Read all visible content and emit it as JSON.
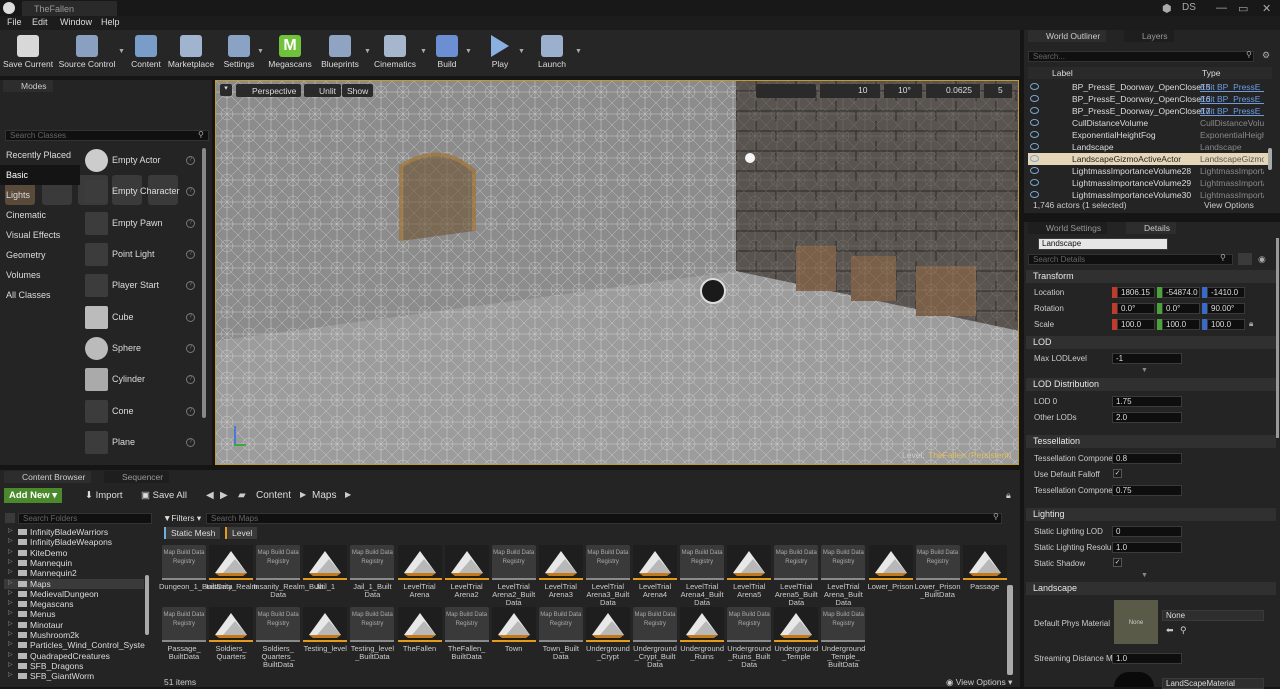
{
  "window": {
    "tab_title": "TheFallen",
    "user_badge": "DS"
  },
  "menu": [
    "File",
    "Edit",
    "Window",
    "Help"
  ],
  "toolbar": [
    {
      "label": "Save Current",
      "icon": "save-icon"
    },
    {
      "label": "Source Control",
      "icon": "source-control-icon"
    },
    {
      "label": "Content",
      "icon": "content-icon"
    },
    {
      "label": "Marketplace",
      "icon": "marketplace-icon"
    },
    {
      "label": "Settings",
      "icon": "settings-icon"
    },
    {
      "label": "Megascans",
      "icon": "megascans-icon"
    },
    {
      "label": "Blueprints",
      "icon": "blueprints-icon"
    },
    {
      "label": "Cinematics",
      "icon": "cinematics-icon"
    },
    {
      "label": "Build",
      "icon": "build-icon"
    },
    {
      "label": "Play",
      "icon": "play-icon"
    },
    {
      "label": "Launch",
      "icon": "launch-icon"
    }
  ],
  "modes": {
    "tab": "Modes",
    "search_placeholder": "Search Classes",
    "categories": [
      "Recently Placed",
      "Basic",
      "Lights",
      "Cinematic",
      "Visual Effects",
      "Geometry",
      "Volumes",
      "All Classes"
    ],
    "selected_category": "Basic",
    "items": [
      "Empty Actor",
      "Empty Character",
      "Empty Pawn",
      "Point Light",
      "Player Start",
      "Cube",
      "Sphere",
      "Cylinder",
      "Cone",
      "Plane"
    ]
  },
  "viewport": {
    "perspective": "Perspective",
    "view_mode": "Unlit",
    "show": "Show",
    "grid_snap": "10",
    "rotation_snap": "10°",
    "scale_snap": "0.0625",
    "camera_speed": "5",
    "level_label": "Level:",
    "level_name": "TheFallen (Persistent)"
  },
  "outliner": {
    "tabs": [
      "World Outliner",
      "Layers"
    ],
    "search_placeholder": "Search...",
    "col_label": "Label",
    "col_type": "Type",
    "rows": [
      {
        "label": "BP_PressE_Doorway_OpenClose15",
        "type": "Edit BP_PressE_",
        "link": true
      },
      {
        "label": "BP_PressE_Doorway_OpenClose16",
        "type": "Edit BP_PressE_",
        "link": true
      },
      {
        "label": "BP_PressE_Doorway_OpenClose17",
        "type": "Edit BP_PressE_",
        "link": true
      },
      {
        "label": "CullDistanceVolume",
        "type": "CullDistanceVolume",
        "link": false
      },
      {
        "label": "ExponentialHeightFog",
        "type": "ExponentialHeight",
        "link": false
      },
      {
        "label": "Landscape",
        "type": "Landscape",
        "link": false
      },
      {
        "label": "LandscapeGizmoActiveActor",
        "type": "LandscapeGizmo",
        "link": false
      },
      {
        "label": "LightmassImportanceVolume28",
        "type": "LightmassImporta",
        "link": false
      },
      {
        "label": "LightmassImportanceVolume29",
        "type": "LightmassImporta",
        "link": false
      },
      {
        "label": "LightmassImportanceVolume30",
        "type": "LightmassImporta",
        "link": false
      }
    ],
    "status": "1,746 actors (1 selected)",
    "view_options": "View Options"
  },
  "details": {
    "tabs": [
      "World Settings",
      "Details"
    ],
    "actor_name": "Landscape",
    "search_placeholder": "Search Details",
    "transform": {
      "section": "Transform",
      "location_label": "Location",
      "location": [
        "1806.15",
        "-54874.0",
        "-1410.0"
      ],
      "rotation_label": "Rotation",
      "rotation": [
        "0.0°",
        "0.0°",
        "90.00°"
      ],
      "scale_label": "Scale",
      "scale": [
        "100.0",
        "100.0",
        "100.0"
      ]
    },
    "lod": {
      "section": "LOD",
      "max_lod_label": "Max LODLevel",
      "max_lod": "-1"
    },
    "lod_distribution": {
      "section": "LOD Distribution",
      "lod0_label": "LOD 0",
      "lod0": "1.75",
      "other_label": "Other LODs",
      "other": "2.0"
    },
    "tessellation": {
      "section": "Tessellation",
      "comp1_label": "Tessellation Compone",
      "comp1": "0.8",
      "falloff_label": "Use Default Falloff",
      "comp2_label": "Tessellation Compone",
      "comp2": "0.75"
    },
    "lighting": {
      "section": "Lighting",
      "lod_label": "Static Lighting LOD",
      "lod": "0",
      "res_label": "Static Lighting Resolu",
      "res": "1.0",
      "shadow_label": "Static Shadow"
    },
    "landscape": {
      "section": "Landscape",
      "phys_label": "Default Phys Material",
      "phys_value": "None",
      "phys_thumb": "None",
      "stream_label": "Streaming Distance M",
      "stream": "1.0",
      "material": "LandScapeMaterial"
    }
  },
  "content_browser": {
    "tabs": [
      "Content Browser",
      "Sequencer"
    ],
    "add_new": "Add New",
    "import": "Import",
    "save_all": "Save All",
    "path": [
      "Content",
      "Maps"
    ],
    "folder_search": "Search Folders",
    "filters": "Filters",
    "asset_search": "Search Maps",
    "filter_chips": [
      "Static Mesh",
      "Level"
    ],
    "folders": [
      "InfinityBladeWarriors",
      "InfinityBladeWeapons",
      "KiteDemo",
      "Mannequin",
      "Mannequin2",
      "Maps",
      "MedievalDungeon",
      "Megascans",
      "Menus",
      "Minotaur",
      "Mushroom2k",
      "Particles_Wind_Control_Syste",
      "QuadrapedCreatures",
      "SFB_Dragons",
      "SFB_GiantWorm"
    ],
    "selected_folder": "Maps",
    "assets_row1": [
      {
        "name": "Dungeon_1_BuiltData",
        "kind": "mbd"
      },
      {
        "name": "Insanity_Realm",
        "kind": "lvl"
      },
      {
        "name": "Insanity_Realm_Built Data",
        "kind": "mbd"
      },
      {
        "name": "Jail_1",
        "kind": "lvl"
      },
      {
        "name": "Jail_1_Built Data",
        "kind": "mbd"
      },
      {
        "name": "LevelTrial Arena",
        "kind": "lvl"
      },
      {
        "name": "LevelTrial Arena2",
        "kind": "lvl"
      },
      {
        "name": "LevelTrial Arena2_Built Data",
        "kind": "mbd"
      },
      {
        "name": "LevelTrial Arena3",
        "kind": "lvl"
      },
      {
        "name": "LevelTrial Arena3_Built Data",
        "kind": "mbd"
      },
      {
        "name": "LevelTrial Arena4",
        "kind": "lvl"
      },
      {
        "name": "LevelTrial Arena4_Built Data",
        "kind": "mbd"
      },
      {
        "name": "LevelTrial Arena5",
        "kind": "lvl"
      },
      {
        "name": "LevelTrial Arena5_Built Data",
        "kind": "mbd"
      },
      {
        "name": "LevelTrial Arena_Built Data",
        "kind": "mbd"
      },
      {
        "name": "Lower_Prison",
        "kind": "lvl"
      },
      {
        "name": "Lower_Prison _BuiltData",
        "kind": "mbd"
      },
      {
        "name": "Passage",
        "kind": "lvl"
      }
    ],
    "assets_row2": [
      {
        "name": "Passage_ BuiltData",
        "kind": "mbd"
      },
      {
        "name": "Soldiers_ Quarters",
        "kind": "lvl"
      },
      {
        "name": "Soldiers_ Quarters_ BuiltData",
        "kind": "mbd"
      },
      {
        "name": "Testing_level",
        "kind": "lvl"
      },
      {
        "name": "Testing_level _BuiltData",
        "kind": "mbd"
      },
      {
        "name": "TheFallen",
        "kind": "lvl"
      },
      {
        "name": "TheFallen_ BuiltData",
        "kind": "mbd"
      },
      {
        "name": "Town",
        "kind": "lvl"
      },
      {
        "name": "Town_Built Data",
        "kind": "mbd"
      },
      {
        "name": "Underground _Crypt",
        "kind": "lvl"
      },
      {
        "name": "Underground _Crypt_Built Data",
        "kind": "mbd"
      },
      {
        "name": "Underground _Ruins",
        "kind": "lvl"
      },
      {
        "name": "Underground _Ruins_Built Data",
        "kind": "mbd"
      },
      {
        "name": "Underground _Temple",
        "kind": "lvl"
      },
      {
        "name": "Underground _Temple_ BuiltData",
        "kind": "mbd"
      }
    ],
    "map_build_label": "Map Build Data Registry",
    "item_count": "51 items",
    "view_options": "View Options"
  },
  "colors": {
    "accent": "#c39a2c",
    "level_bar": "#e59a1c",
    "mbd_bar": "#8a8a8a",
    "selection": "#3a3a3a",
    "add_new": "#4a8a2c"
  }
}
